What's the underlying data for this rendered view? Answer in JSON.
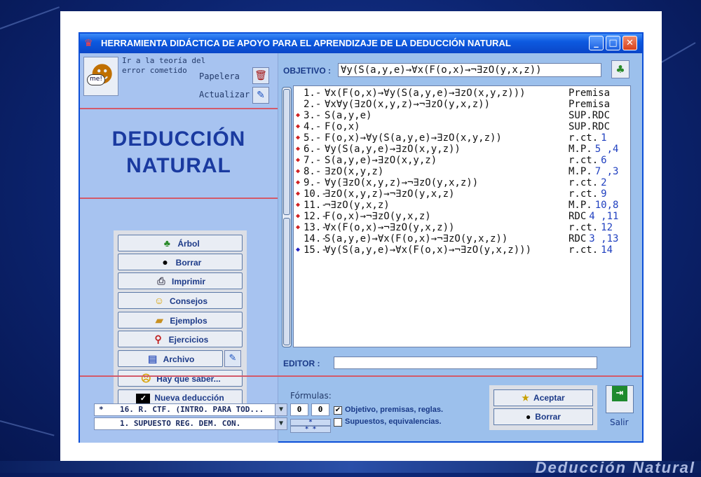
{
  "window": {
    "title": "HERRAMIENTA DIDÁCTICA DE APOYO PARA EL APRENDIZAJE DE LA DEDUCCIÓN NATURAL"
  },
  "slide_footer": "Deducción Natural",
  "left": {
    "help_text_line1": "Ir a la teoría del",
    "help_text_line2": "error cometido",
    "face_bubble": "me!",
    "papelera_label": "Papelera",
    "actualizar_label": "Actualizar",
    "title_line1": "DEDUCCIÓN",
    "title_line2": "NATURAL",
    "menu": [
      {
        "label": "Árbol",
        "icon": "tree-icon"
      },
      {
        "label": "Borrar",
        "icon": "bomb-icon"
      },
      {
        "label": "Imprimir",
        "icon": "printer-icon"
      },
      {
        "label": "Consejos",
        "icon": "thinking-face-icon"
      },
      {
        "label": "Ejemplos",
        "icon": "folder-icon"
      },
      {
        "label": "Ejercicios",
        "icon": "bicycle-icon"
      },
      {
        "label": "Archivo",
        "icon": "file-icon"
      },
      {
        "label": "Hay que saber...",
        "icon": "surprised-face-icon"
      },
      {
        "label": "Nueva deducción",
        "icon": "nike-icon"
      }
    ]
  },
  "objetivo": {
    "label": "OBJETIVO :",
    "value": "∀y(S(a,y,e)→∀x(F(o,x)→¬∃zO(y,x,z))"
  },
  "deduction": {
    "rows": [
      {
        "mark": "",
        "num": "1.-",
        "formula": "∀x(F(o,x)→∀y(S(a,y,e)→∃zO(x,y,z)))",
        "rule": "Premisa",
        "ref": ""
      },
      {
        "mark": "",
        "num": "2.-",
        "formula": "∀x∀y(∃zO(x,y,z)→¬∃zO(y,x,z))",
        "rule": "Premisa",
        "ref": ""
      },
      {
        "mark": "red",
        "num": "3.-",
        "formula": "S(a,y,e)",
        "rule": "SUP.RDC",
        "ref": ""
      },
      {
        "mark": "red",
        "num": "4.-",
        "formula": "F(o,x)",
        "rule": "SUP.RDC",
        "ref": ""
      },
      {
        "mark": "red",
        "num": "5.-",
        "formula": "F(o,x)→∀y(S(a,y,e)→∃zO(x,y,z))",
        "rule": "r.ct.",
        "ref": "1"
      },
      {
        "mark": "red",
        "num": "6.-",
        "formula": "∀y(S(a,y,e)→∃zO(x,y,z))",
        "rule": "M.P.",
        "ref": "5 ,4"
      },
      {
        "mark": "red",
        "num": "7.-",
        "formula": "S(a,y,e)→∃zO(x,y,z)",
        "rule": "r.ct.",
        "ref": "6"
      },
      {
        "mark": "red",
        "num": "8.-",
        "formula": "∃zO(x,y,z)",
        "rule": "M.P.",
        "ref": "7 ,3"
      },
      {
        "mark": "red",
        "num": "9.-",
        "formula": "∀y(∃zO(x,y,z)→¬∃zO(y,x,z))",
        "rule": "r.ct.",
        "ref": "2"
      },
      {
        "mark": "red",
        "num": "10.-",
        "formula": "∃zO(x,y,z)→¬∃zO(y,x,z)",
        "rule": "r.ct.",
        "ref": "9"
      },
      {
        "mark": "red",
        "num": "11.-",
        "formula": "¬∃zO(y,x,z)",
        "rule": "M.P.",
        "ref": "10,8"
      },
      {
        "mark": "red",
        "num": "12.-",
        "formula": "F(o,x)→¬∃zO(y,x,z)",
        "rule": "RDC",
        "ref": "4 ,11"
      },
      {
        "mark": "red",
        "num": "13.-",
        "formula": "∀x(F(o,x)→¬∃zO(y,x,z))",
        "rule": "r.ct.",
        "ref": "12"
      },
      {
        "mark": "",
        "num": "14.-",
        "formula": "S(a,y,e)→∀x(F(o,x)→¬∃zO(y,x,z))",
        "rule": "RDC",
        "ref": "3 ,13"
      },
      {
        "mark": "blue",
        "num": "15.-",
        "formula": "∀y(S(a,y,e)→∀x(F(o,x)→¬∃zO(y,x,z)))",
        "rule": "r.ct.",
        "ref": "14"
      }
    ]
  },
  "editor": {
    "label": "EDITOR :",
    "value": ""
  },
  "bottom": {
    "formulas_label": "Fórmulas:",
    "combo1_prefix": "*",
    "combo1": "16. R. CTF. (INTRO. PARA TOD...",
    "combo2": "1.  SUPUESTO REG. DEM. CON.",
    "count1": "0",
    "count2": "0",
    "stars": "*",
    "stars2": "*    *",
    "check1_label": "Objetivo, premisas, reglas.",
    "check1_checked": "✔",
    "check2_label": "Supuestos, equivalencias.",
    "aceptar_label": "Aceptar",
    "borrar_label": "Borrar",
    "salir_label": "Salir"
  }
}
